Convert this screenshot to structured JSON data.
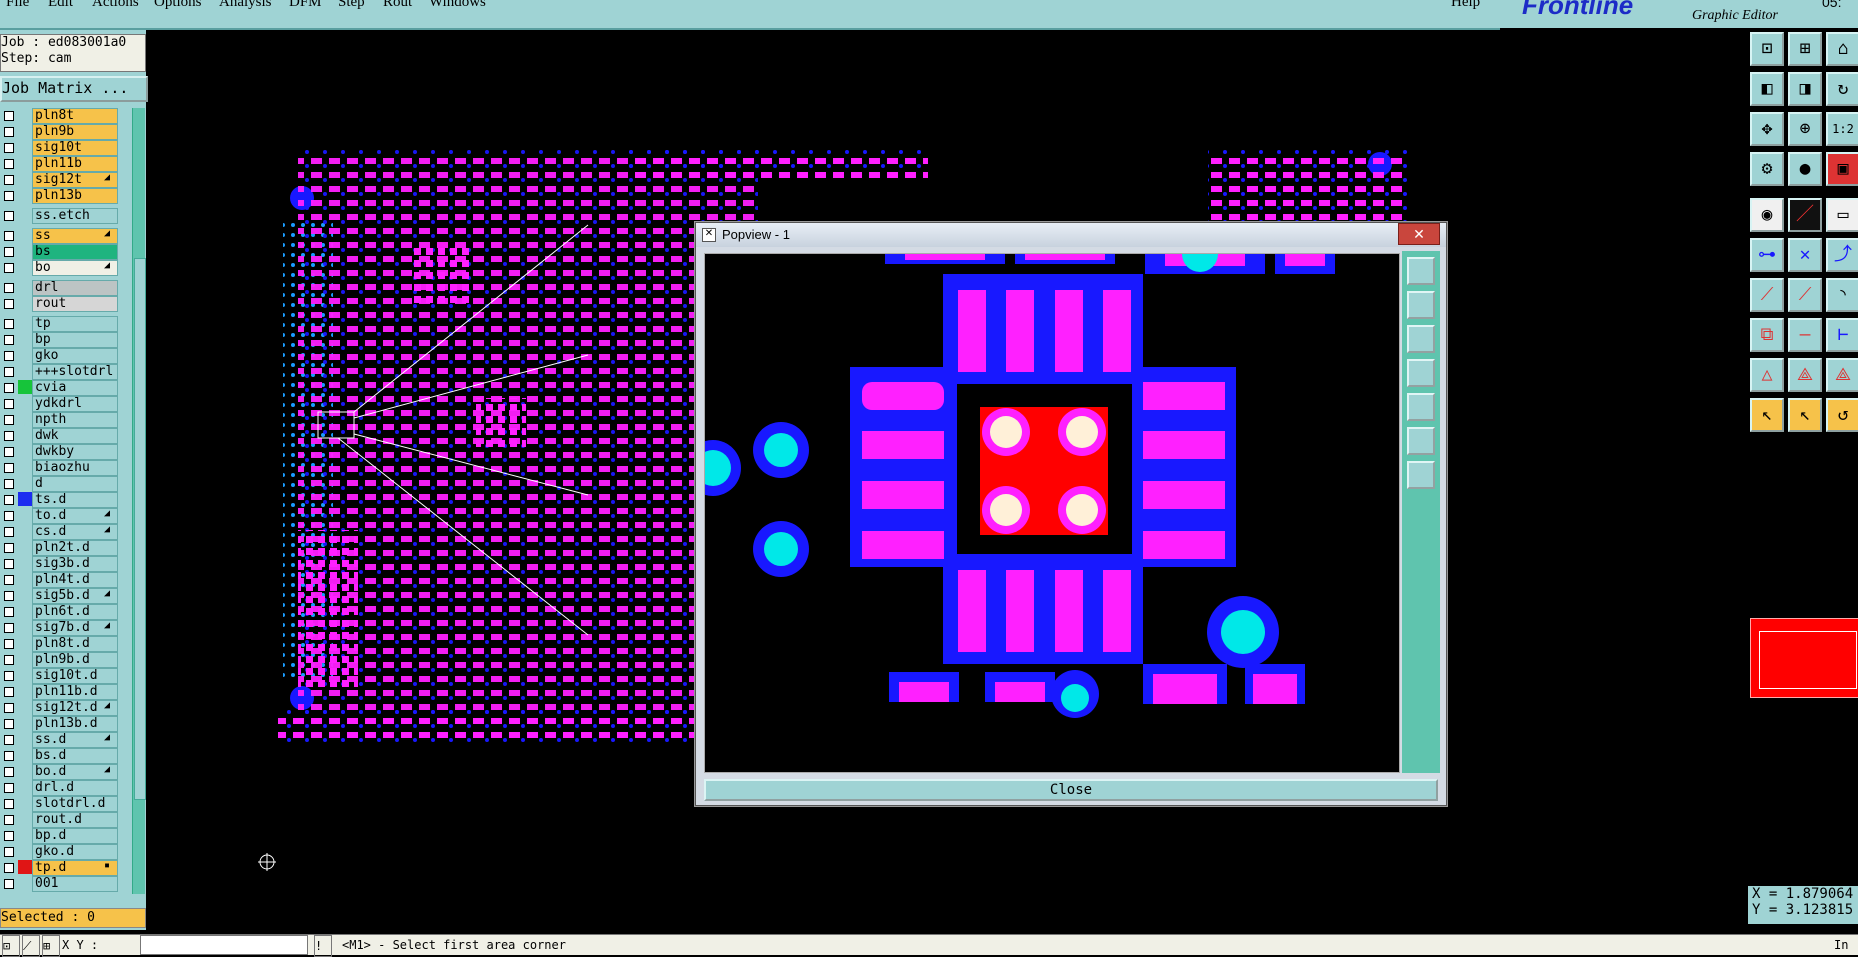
{
  "menu": [
    "File",
    "Edit",
    "Actions",
    "Options",
    "Analysis",
    "DFM",
    "Step",
    "Rout",
    "Windows",
    "Help"
  ],
  "brand": {
    "logo": "Frontline",
    "subtitle": "Graphic Editor",
    "time": "05:"
  },
  "job": {
    "line1": "Job : ed083001a0",
    "line2": "Step: cam",
    "matrix_label": "Job Matrix ..."
  },
  "layers": [
    {
      "name": "pln8t",
      "color": "#f6c24a",
      "swatch": ""
    },
    {
      "name": "pln9b",
      "color": "#f6c24a",
      "swatch": ""
    },
    {
      "name": "sig10t",
      "color": "#f6c24a",
      "swatch": ""
    },
    {
      "name": "pln11b",
      "color": "#f6c24a",
      "swatch": ""
    },
    {
      "name": "sig12t",
      "color": "#f6c24a",
      "swatch": "",
      "flag": "◢"
    },
    {
      "name": "pln13b",
      "color": "#f6c24a",
      "swatch": ""
    },
    {
      "name": "ss.etch",
      "color": "#9fd3d4",
      "swatch": "",
      "gap": true
    },
    {
      "name": "ss",
      "color": "#f6c24a",
      "swatch": "",
      "flag": "◢",
      "gap": true
    },
    {
      "name": "bs",
      "color": "#1fb47f",
      "swatch": ""
    },
    {
      "name": "bo",
      "color": "#f0f0e6",
      "swatch": "",
      "flag": "◢"
    },
    {
      "name": "drl",
      "color": "#bcc4c4",
      "swatch": "",
      "gap": true
    },
    {
      "name": "rout",
      "color": "#d6d6d6",
      "swatch": ""
    },
    {
      "name": "tp",
      "color": "#9fd3d4",
      "swatch": "",
      "gap": true
    },
    {
      "name": "bp",
      "color": "#9fd3d4",
      "swatch": ""
    },
    {
      "name": "gko",
      "color": "#9fd3d4",
      "swatch": ""
    },
    {
      "name": "+++slotdrl",
      "color": "#9fd3d4",
      "swatch": ""
    },
    {
      "name": "cvia",
      "color": "#9fd3d4",
      "swatch": "#16c43a"
    },
    {
      "name": "ydkdrl",
      "color": "#9fd3d4",
      "swatch": ""
    },
    {
      "name": "npth",
      "color": "#9fd3d4",
      "swatch": ""
    },
    {
      "name": "dwk",
      "color": "#9fd3d4",
      "swatch": ""
    },
    {
      "name": "dwkby",
      "color": "#9fd3d4",
      "swatch": ""
    },
    {
      "name": "biaozhu",
      "color": "#9fd3d4",
      "swatch": ""
    },
    {
      "name": "d",
      "color": "#9fd3d4",
      "swatch": ""
    },
    {
      "name": "ts.d",
      "color": "#9fd3d4",
      "swatch": "#1c2cf0"
    },
    {
      "name": "to.d",
      "color": "#9fd3d4",
      "swatch": "",
      "flag": "◢"
    },
    {
      "name": "cs.d",
      "color": "#9fd3d4",
      "swatch": "",
      "flag": "◢"
    },
    {
      "name": "pln2t.d",
      "color": "#9fd3d4",
      "swatch": ""
    },
    {
      "name": "sig3b.d",
      "color": "#9fd3d4",
      "swatch": ""
    },
    {
      "name": "pln4t.d",
      "color": "#9fd3d4",
      "swatch": ""
    },
    {
      "name": "sig5b.d",
      "color": "#9fd3d4",
      "swatch": "",
      "flag": "◢"
    },
    {
      "name": "pln6t.d",
      "color": "#9fd3d4",
      "swatch": ""
    },
    {
      "name": "sig7b.d",
      "color": "#9fd3d4",
      "swatch": "",
      "flag": "◢"
    },
    {
      "name": "pln8t.d",
      "color": "#9fd3d4",
      "swatch": ""
    },
    {
      "name": "pln9b.d",
      "color": "#9fd3d4",
      "swatch": ""
    },
    {
      "name": "sig10t.d",
      "color": "#9fd3d4",
      "swatch": ""
    },
    {
      "name": "pln11b.d",
      "color": "#9fd3d4",
      "swatch": ""
    },
    {
      "name": "sig12t.d",
      "color": "#9fd3d4",
      "swatch": "",
      "flag": "◢"
    },
    {
      "name": "pln13b.d",
      "color": "#9fd3d4",
      "swatch": ""
    },
    {
      "name": "ss.d",
      "color": "#9fd3d4",
      "swatch": "",
      "flag": "◢"
    },
    {
      "name": "bs.d",
      "color": "#9fd3d4",
      "swatch": ""
    },
    {
      "name": "bo.d",
      "color": "#9fd3d4",
      "swatch": "",
      "flag": "◢"
    },
    {
      "name": "drl.d",
      "color": "#9fd3d4",
      "swatch": ""
    },
    {
      "name": "slotdrl.d",
      "color": "#9fd3d4",
      "swatch": ""
    },
    {
      "name": "rout.d",
      "color": "#9fd3d4",
      "swatch": ""
    },
    {
      "name": "bp.d",
      "color": "#9fd3d4",
      "swatch": ""
    },
    {
      "name": "gko.d",
      "color": "#9fd3d4",
      "swatch": ""
    },
    {
      "name": "tp.d",
      "color": "#f6c24a",
      "swatch": "#e01515",
      "flag": "▪"
    },
    {
      "name": "001",
      "color": "#9fd3d4",
      "swatch": ""
    }
  ],
  "selected_label": "Selected : 0",
  "popup": {
    "title": "Popview - 1",
    "close_label": "Close"
  },
  "coords": {
    "x": "X = 1.879064",
    "y": "Y = 3.123815"
  },
  "status": {
    "xy_label": "X Y :",
    "xy_value": "",
    "message": "<M1> - Select first area corner",
    "right": "In"
  },
  "colors": {
    "board_pad": "#ff20ff",
    "board_via": "#1818ff",
    "via_hole": "#00e8e8",
    "highlight": "#ff0000",
    "panel": "#9fd3d4"
  }
}
